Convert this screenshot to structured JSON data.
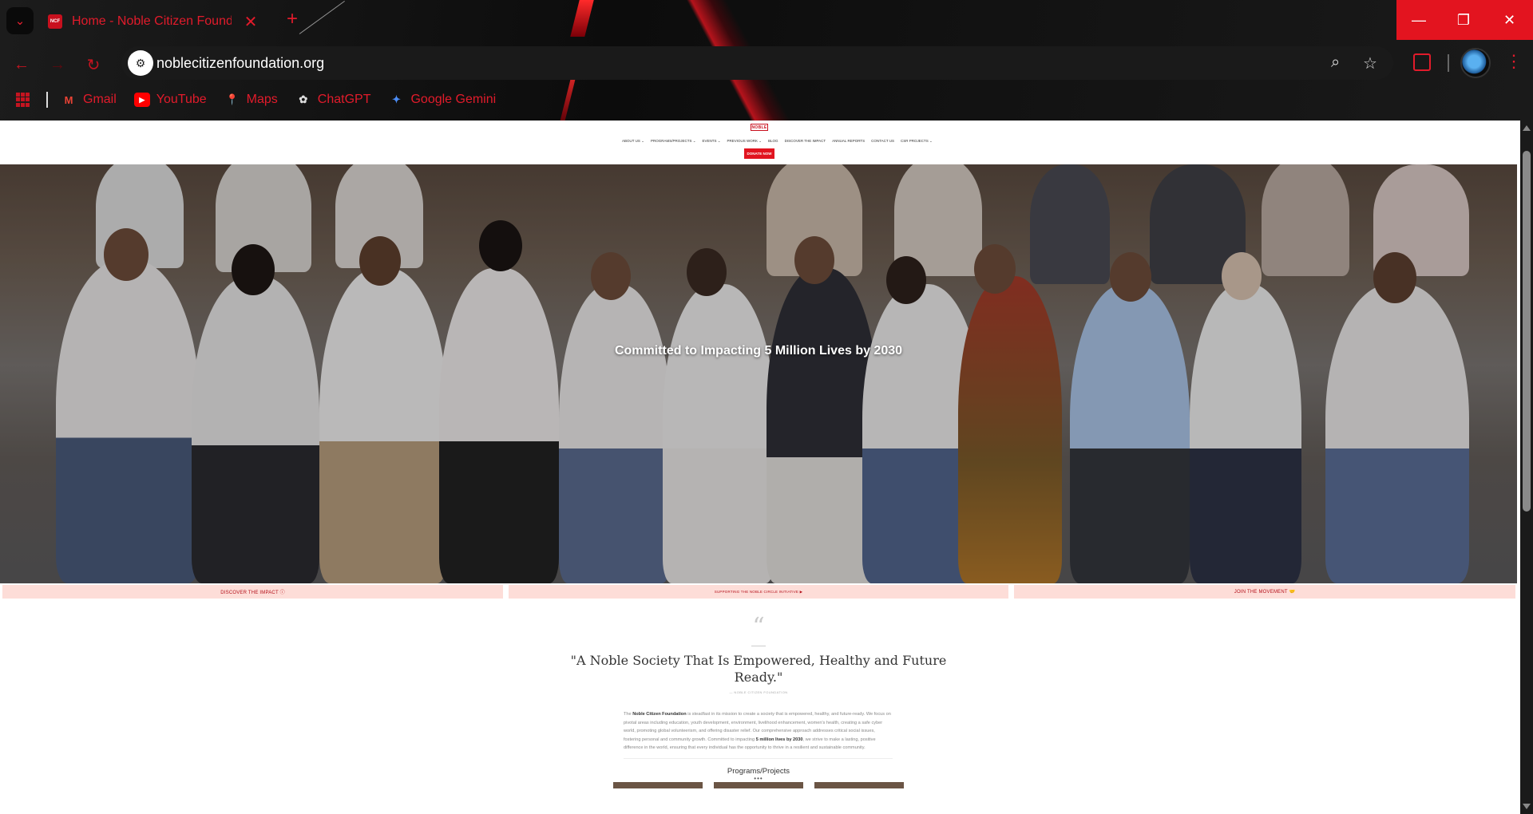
{
  "browser": {
    "tab": {
      "favicon_text": "NCF",
      "title": "Home - Noble Citizen Foundation"
    },
    "address": "noblecitizenfoundation.org",
    "bookmarks": [
      {
        "label": "Gmail",
        "icon": "gmail-icon"
      },
      {
        "label": "YouTube",
        "icon": "youtube-icon"
      },
      {
        "label": "Maps",
        "icon": "maps-icon"
      },
      {
        "label": "ChatGPT",
        "icon": "chatgpt-icon"
      },
      {
        "label": "Google Gemini",
        "icon": "gemini-icon"
      }
    ],
    "accent_color": "#e21b2b"
  },
  "site": {
    "logo_text": "NOBLE",
    "nav": [
      "ABOUT US ⌄",
      "PROGRAMS/PROJECTS ⌄",
      "EVENTS ⌄",
      "PREVIOUS WORK ⌄",
      "BLOG",
      "DISCOVER THE IMPACT",
      "ANNUAL REPORTS",
      "CONTACT US",
      "CSR PROJECTS ⌄"
    ],
    "donate_label": "DONATE NOW",
    "hero_title": "Committed to Impacting 5 Million Lives by 2030",
    "strip": [
      "DISCOVER THE IMPACT ⓘ",
      "SUPPORTING THE NOBLE CIRCLE INITIATIVE ▶",
      "JOIN THE MOVEMENT 🤝"
    ],
    "quote_mark": "“",
    "quote": "\"A Noble Society That Is Empowered, Healthy and Future Ready.\"",
    "quote_attribution": "— NOBLE CITIZEN FOUNDATION",
    "about_intro": "The ",
    "about_org": "Noble Citizen Foundation",
    "about_body": " is steadfast in its mission to create a society that is empowered, healthy, and future-ready. We focus on pivotal areas including education, youth development, environment, livelihood enhancement, women's health, creating a safe cyber world, promoting global volunteerism, and offering disaster relief. Our comprehensive approach addresses critical social issues, fostering personal and community growth. Committed to impacting ",
    "about_highlight": "5 million lives by 2030",
    "about_end": ", we strive to make a lasting, positive difference in the world, ensuring that every individual has the opportunity to thrive in a resilient and sustainable community.",
    "programs_title": "Programs/Projects",
    "programs_dots": "•••"
  }
}
